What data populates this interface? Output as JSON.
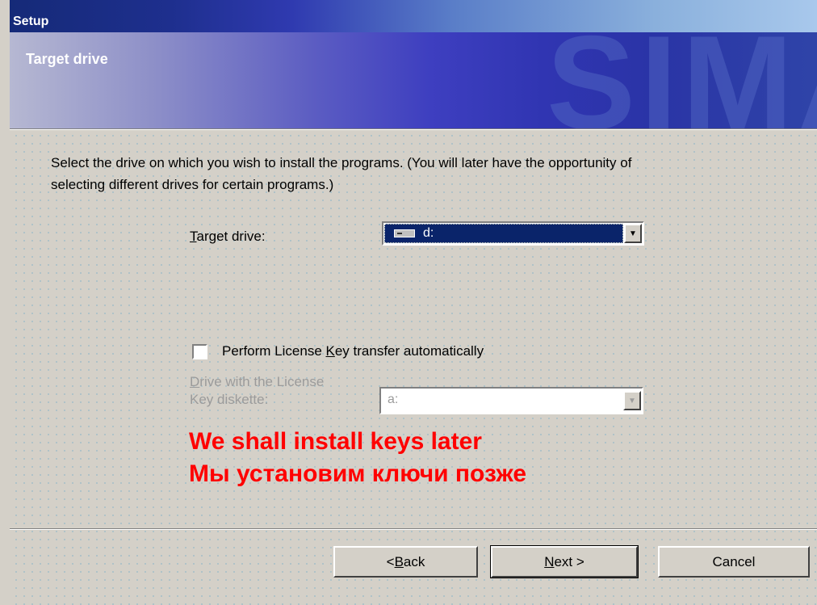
{
  "window": {
    "title": "Setup",
    "subtitle": "Target drive",
    "logo_text": "SIMA"
  },
  "instructions": {
    "line1": "Select the drive on which you wish to install the programs. (You will later have the opportunity of",
    "line2": "selecting different drives for certain programs.)"
  },
  "target_drive": {
    "label_prefix": "T",
    "label_rest": "arget drive:",
    "value": "d:"
  },
  "license": {
    "checkbox_label_a": "Perform License ",
    "checkbox_label_key": "K",
    "checkbox_label_b": "ey transfer automatically",
    "checked": false,
    "drive_label_line1_prefix": "D",
    "drive_label_line1_rest": "rive with the License",
    "drive_label_line2": "Key diskette:",
    "drive_value": "a:"
  },
  "notes": {
    "english": "We shall install keys later",
    "russian": "Мы установим ключи позже"
  },
  "buttons": {
    "back_prefix": "< ",
    "back_key": "B",
    "back_rest": "ack",
    "next_key": "N",
    "next_rest": "ext >",
    "cancel": "Cancel"
  },
  "colors": {
    "note_red": "#ff0000",
    "selection_blue": "#0a246a",
    "dialog_gray": "#d4d0c8"
  }
}
